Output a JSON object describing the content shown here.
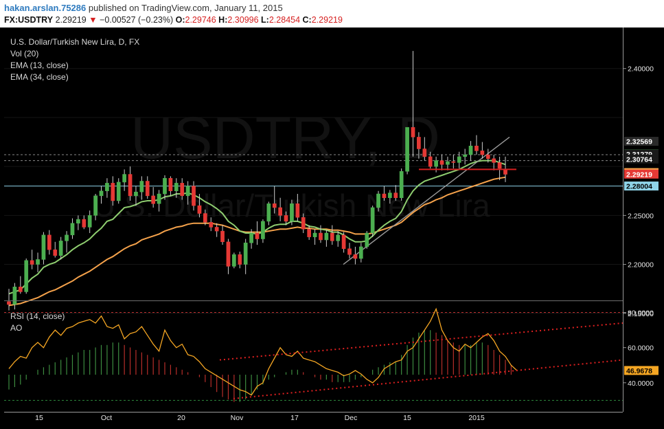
{
  "header": {
    "user": "hakan.arslan.75286",
    "published_text": "published on TradingView.com, January 11, 2015",
    "symbol": "FX:USDTRY",
    "last": "2.29219",
    "change": "−0.00527 (−0.23%)",
    "o_label": "O:",
    "o_value": "2.29746",
    "h_label": "H:",
    "h_value": "2.30996",
    "l_label": "L:",
    "l_value": "2.28454",
    "c_label": "C:",
    "c_value": "2.29219"
  },
  "legend": {
    "title": "U.S. Dollar/Turkish New Lira, D, FX",
    "vol": "Vol (20)",
    "ema13": "EMA (13, close)",
    "ema34": "EMA (34, close)",
    "rsi": "RSI (14, close)",
    "ao": "AO"
  },
  "watermark": {
    "symbol": "USDTRY, D",
    "name": "U.S. Dollar/Turkish New Lira"
  },
  "colors": {
    "up": "#4caf50",
    "down": "#e53935",
    "ema13": "#8fce70",
    "ema34": "#f5a24b",
    "rsi": "#f5a623",
    "resistance": "#d62020",
    "support": "#8fd3e8"
  },
  "x_axis_labels": [
    "15",
    "Oct",
    "20",
    "Nov",
    "17",
    "Dec",
    "15",
    "2015"
  ],
  "price_axis": {
    "ticks": [
      "2.40000",
      "2.25000",
      "2.20000",
      "2.15000"
    ],
    "markers": [
      {
        "label": "2.32569",
        "bg": "#2a2a2a",
        "fg": "#ffffff"
      },
      {
        "label": "2.31293",
        "bg": "#4caf50",
        "fg": "#ffffff"
      },
      {
        "label": "2.31279",
        "bg": "#1a1a1a",
        "fg": "#ffffff"
      },
      {
        "label": "2.30764",
        "bg": "#1a1a1a",
        "fg": "#ffffff"
      },
      {
        "label": "2.29375",
        "bg": "#f5a24b",
        "fg": "#000000"
      },
      {
        "label": "2.29219",
        "bg": "#e53935",
        "fg": "#ffffff"
      },
      {
        "label": "2.28004",
        "bg": "#8fd3e8",
        "fg": "#000000"
      }
    ]
  },
  "rsi_axis": {
    "ticks": [
      "80.0000",
      "60.0000",
      "40.0000"
    ],
    "marker": {
      "label": "46.9678",
      "bg": "#f5a623",
      "fg": "#000000"
    }
  },
  "chart_data": {
    "type": "candlestick",
    "title": "U.S. Dollar/Turkish New Lira, D, FX",
    "symbol": "FX:USDTRY",
    "x_ticks": [
      "15",
      "Oct",
      "20",
      "Nov",
      "17",
      "Dec",
      "15",
      "2015"
    ],
    "ylim": [
      2.14,
      2.43
    ],
    "candles": [
      [
        2.162,
        2.175,
        2.153,
        2.159
      ],
      [
        2.159,
        2.181,
        2.154,
        2.177
      ],
      [
        2.177,
        2.188,
        2.17,
        2.172
      ],
      [
        2.172,
        2.206,
        2.17,
        2.204
      ],
      [
        2.204,
        2.215,
        2.195,
        2.2
      ],
      [
        2.2,
        2.212,
        2.192,
        2.205
      ],
      [
        2.205,
        2.233,
        2.2,
        2.23
      ],
      [
        2.23,
        2.235,
        2.21,
        2.215
      ],
      [
        2.215,
        2.223,
        2.207,
        2.209
      ],
      [
        2.209,
        2.228,
        2.205,
        2.224
      ],
      [
        2.224,
        2.234,
        2.212,
        2.23
      ],
      [
        2.23,
        2.247,
        2.226,
        2.242
      ],
      [
        2.242,
        2.25,
        2.235,
        2.246
      ],
      [
        2.246,
        2.25,
        2.236,
        2.238
      ],
      [
        2.238,
        2.255,
        2.232,
        2.25
      ],
      [
        2.25,
        2.272,
        2.245,
        2.27
      ],
      [
        2.27,
        2.28,
        2.262,
        2.275
      ],
      [
        2.275,
        2.288,
        2.268,
        2.283
      ],
      [
        2.283,
        2.29,
        2.26,
        2.265
      ],
      [
        2.265,
        2.288,
        2.262,
        2.284
      ],
      [
        2.284,
        2.297,
        2.275,
        2.292
      ],
      [
        2.292,
        2.3,
        2.265,
        2.27
      ],
      [
        2.27,
        2.28,
        2.26,
        2.274
      ],
      [
        2.274,
        2.29,
        2.266,
        2.285
      ],
      [
        2.285,
        2.29,
        2.267,
        2.27
      ],
      [
        2.27,
        2.279,
        2.258,
        2.262
      ],
      [
        2.262,
        2.276,
        2.254,
        2.272
      ],
      [
        2.272,
        2.291,
        2.266,
        2.288
      ],
      [
        2.288,
        2.29,
        2.27,
        2.275
      ],
      [
        2.275,
        2.288,
        2.268,
        2.283
      ],
      [
        2.283,
        2.288,
        2.266,
        2.27
      ],
      [
        2.27,
        2.285,
        2.261,
        2.28
      ],
      [
        2.28,
        2.285,
        2.255,
        2.26
      ],
      [
        2.26,
        2.272,
        2.248,
        2.252
      ],
      [
        2.252,
        2.256,
        2.24,
        2.243
      ],
      [
        2.243,
        2.248,
        2.234,
        2.238
      ],
      [
        2.238,
        2.242,
        2.228,
        2.234
      ],
      [
        2.234,
        2.24,
        2.22,
        2.223
      ],
      [
        2.223,
        2.226,
        2.19,
        2.198
      ],
      [
        2.198,
        2.212,
        2.196,
        2.21
      ],
      [
        2.21,
        2.213,
        2.196,
        2.2
      ],
      [
        2.2,
        2.226,
        2.19,
        2.222
      ],
      [
        2.222,
        2.236,
        2.216,
        2.232
      ],
      [
        2.232,
        2.244,
        2.22,
        2.226
      ],
      [
        2.226,
        2.246,
        2.222,
        2.244
      ],
      [
        2.244,
        2.264,
        2.24,
        2.262
      ],
      [
        2.262,
        2.28,
        2.252,
        2.258
      ],
      [
        2.258,
        2.268,
        2.244,
        2.25
      ],
      [
        2.25,
        2.254,
        2.24,
        2.244
      ],
      [
        2.244,
        2.266,
        2.24,
        2.262
      ],
      [
        2.262,
        2.272,
        2.244,
        2.248
      ],
      [
        2.248,
        2.252,
        2.232,
        2.236
      ],
      [
        2.236,
        2.24,
        2.225,
        2.228
      ],
      [
        2.228,
        2.236,
        2.22,
        2.232
      ],
      [
        2.232,
        2.24,
        2.222,
        2.225
      ],
      [
        2.225,
        2.235,
        2.218,
        2.232
      ],
      [
        2.232,
        2.24,
        2.22,
        2.224
      ],
      [
        2.224,
        2.234,
        2.218,
        2.23
      ],
      [
        2.23,
        2.233,
        2.212,
        2.216
      ],
      [
        2.216,
        2.222,
        2.206,
        2.21
      ],
      [
        2.21,
        2.218,
        2.2,
        2.206
      ],
      [
        2.206,
        2.222,
        2.202,
        2.218
      ],
      [
        2.218,
        2.234,
        2.216,
        2.232
      ],
      [
        2.232,
        2.26,
        2.228,
        2.258
      ],
      [
        2.258,
        2.275,
        2.254,
        2.272
      ],
      [
        2.272,
        2.28,
        2.265,
        2.268
      ],
      [
        2.268,
        2.276,
        2.262,
        2.273
      ],
      [
        2.273,
        2.281,
        2.265,
        2.268
      ],
      [
        2.268,
        2.298,
        2.265,
        2.295
      ],
      [
        2.295,
        2.336,
        2.292,
        2.34
      ],
      [
        2.34,
        2.418,
        2.31,
        2.33
      ],
      [
        2.33,
        2.335,
        2.308,
        2.318
      ],
      [
        2.318,
        2.33,
        2.306,
        2.31
      ],
      [
        2.31,
        2.315,
        2.298,
        2.3
      ],
      [
        2.3,
        2.31,
        2.294,
        2.306
      ],
      [
        2.306,
        2.312,
        2.296,
        2.302
      ],
      [
        2.302,
        2.31,
        2.296,
        2.305
      ],
      [
        2.305,
        2.312,
        2.298,
        2.304
      ],
      [
        2.304,
        2.315,
        2.298,
        2.31
      ],
      [
        2.31,
        2.318,
        2.302,
        2.312
      ],
      [
        2.312,
        2.326,
        2.306,
        2.321
      ],
      [
        2.321,
        2.332,
        2.312,
        2.316
      ],
      [
        2.316,
        2.325,
        2.308,
        2.312
      ],
      [
        2.312,
        2.318,
        2.304,
        2.308
      ],
      [
        2.308,
        2.312,
        2.296,
        2.304
      ],
      [
        2.304,
        2.31,
        2.286,
        2.298
      ],
      [
        2.297,
        2.31,
        2.284,
        2.292
      ]
    ],
    "ema13": [
      2.17,
      2.172,
      2.174,
      2.18,
      2.186,
      2.19,
      2.197,
      2.2,
      2.202,
      2.206,
      2.21,
      2.215,
      2.219,
      2.222,
      2.226,
      2.232,
      2.237,
      2.244,
      2.246,
      2.252,
      2.258,
      2.259,
      2.261,
      2.264,
      2.265,
      2.265,
      2.266,
      2.269,
      2.27,
      2.272,
      2.272,
      2.273,
      2.271,
      2.268,
      2.264,
      2.261,
      2.257,
      2.252,
      2.244,
      2.24,
      2.234,
      2.232,
      2.232,
      2.231,
      2.233,
      2.237,
      2.24,
      2.241,
      2.241,
      2.244,
      2.244,
      2.242,
      2.239,
      2.238,
      2.236,
      2.235,
      2.233,
      2.233,
      2.23,
      2.226,
      2.223,
      2.223,
      2.224,
      2.229,
      2.235,
      2.24,
      2.244,
      2.247,
      2.254,
      2.266,
      2.275,
      2.281,
      2.285,
      2.287,
      2.289,
      2.291,
      2.293,
      2.295,
      2.297,
      2.3,
      2.303,
      2.305,
      2.306,
      2.306,
      2.306,
      2.304,
      2.302
    ],
    "ema34": [
      2.158,
      2.159,
      2.16,
      2.162,
      2.164,
      2.166,
      2.169,
      2.172,
      2.174,
      2.177,
      2.18,
      2.183,
      2.187,
      2.19,
      2.193,
      2.197,
      2.201,
      2.205,
      2.208,
      2.212,
      2.216,
      2.219,
      2.221,
      2.225,
      2.227,
      2.229,
      2.231,
      2.234,
      2.236,
      2.238,
      2.239,
      2.241,
      2.242,
      2.242,
      2.242,
      2.242,
      2.241,
      2.24,
      2.238,
      2.236,
      2.234,
      2.233,
      2.233,
      2.233,
      2.233,
      2.234,
      2.235,
      2.236,
      2.236,
      2.237,
      2.238,
      2.237,
      2.237,
      2.236,
      2.236,
      2.236,
      2.235,
      2.235,
      2.234,
      2.233,
      2.231,
      2.231,
      2.231,
      2.232,
      2.234,
      2.236,
      2.238,
      2.24,
      2.243,
      2.248,
      2.253,
      2.257,
      2.261,
      2.263,
      2.266,
      2.268,
      2.271,
      2.273,
      2.275,
      2.277,
      2.279,
      2.281,
      2.283,
      2.285,
      2.287,
      2.288,
      2.289
    ],
    "horizontal_lines": {
      "resistance": 2.297,
      "support": 2.28004
    },
    "trendline": [
      [
        2.2,
        2.33
      ]
    ],
    "rsi": {
      "ylim": [
        27,
        81
      ],
      "values": [
        48.0,
        52.0,
        55.0,
        54.0,
        60.0,
        63.0,
        60.0,
        66.0,
        70.0,
        67.0,
        71.0,
        72.0,
        74.0,
        75.0,
        76.0,
        74.0,
        78.0,
        72.0,
        71.0,
        73.0,
        65.0,
        68.0,
        69.0,
        72.0,
        67.0,
        62.0,
        58.0,
        70.0,
        64.0,
        60.0,
        62.0,
        56.0,
        55.0,
        52.0,
        48.0,
        46.0,
        44.0,
        42.0,
        40.0,
        38.0,
        36.0,
        35.0,
        33.0,
        38.0,
        40.0,
        48.0,
        54.0,
        60.0,
        56.0,
        55.0,
        58.0,
        54.0,
        53.0,
        52.0,
        50.0,
        48.0,
        47.0,
        46.0,
        44.0,
        45.0,
        47.0,
        45.0,
        42.0,
        40.0,
        43.0,
        48.0,
        50.0,
        52.0,
        53.0,
        58.0,
        60.0,
        65.0,
        70.0,
        75.0,
        82.0,
        70.0,
        64.0,
        60.0,
        58.0,
        62.0,
        60.0,
        63.0,
        66.0,
        68.0,
        64.0,
        58.0,
        55.0,
        50.0,
        47.0
      ],
      "levels": [
        80,
        30
      ],
      "trend_upper": [
        [
          53,
          74
        ]
      ],
      "trend_lower": [
        [
          31,
          53
        ]
      ]
    },
    "ao": [
      -6,
      -5,
      -4,
      -2,
      0,
      2,
      3,
      4,
      5,
      6,
      7,
      8,
      9,
      10,
      10,
      11,
      12,
      12,
      13,
      13,
      12,
      11,
      10,
      9,
      8,
      7,
      6,
      5,
      4,
      3,
      2,
      1,
      0,
      -1,
      -3,
      -5,
      -7,
      -9,
      -10,
      -11,
      -11,
      -10,
      -8,
      -6,
      -4,
      -2,
      -1,
      0,
      1,
      2,
      2,
      1,
      0,
      -1,
      -2,
      -2,
      -3,
      -3,
      -3,
      -3,
      -2,
      -1,
      0,
      2,
      3,
      4,
      5,
      5,
      8,
      12,
      15,
      17,
      18,
      18,
      17,
      16,
      14,
      13,
      12,
      12,
      12,
      13,
      13,
      12,
      10,
      8,
      6,
      4
    ]
  }
}
